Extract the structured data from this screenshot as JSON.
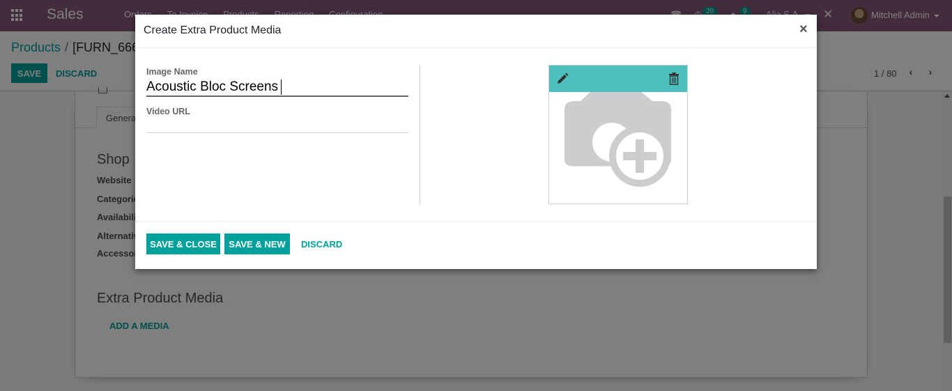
{
  "navbar": {
    "brand": "Sales",
    "menu": [
      "Orders",
      "To Invoice",
      "Products",
      "Reporting",
      "Configuration"
    ],
    "activity_badge": "20",
    "messages_badge": "9",
    "company": "Alia S.A.",
    "user": "Mitchell Admin"
  },
  "control_panel": {
    "breadcrumb_parent": "Products",
    "breadcrumb_separator": "/",
    "breadcrumb_current": "[FURN_666",
    "save_label": "SAVE",
    "discard_label": "DISCARD",
    "pager": "1 / 80"
  },
  "form": {
    "tab_general": "General",
    "shop_title": "Shop",
    "fields": [
      "Website",
      "Categories",
      "Availability",
      "Alternative",
      "Accessory"
    ],
    "media_title": "Extra Product Media",
    "add_media_label": "ADD A MEDIA"
  },
  "modal": {
    "title": "Create Extra Product Media",
    "close_glyph": "×",
    "image_name_label": "Image Name",
    "image_name_value": "Acoustic Bloc Screens",
    "video_url_label": "Video URL",
    "video_url_value": "",
    "save_close_label": "SAVE & CLOSE",
    "save_new_label": "SAVE & NEW",
    "discard_label": "DISCARD"
  },
  "colors": {
    "navbar": "#875a7b",
    "primary": "#00a09d",
    "image_toolbar": "#4dbfbd"
  }
}
